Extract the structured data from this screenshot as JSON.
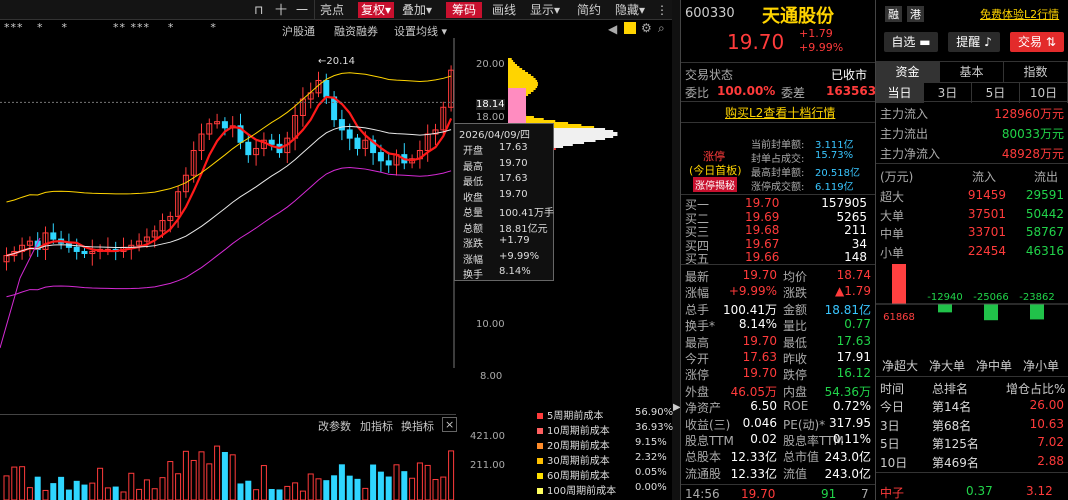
{
  "toolbar": {
    "items": [
      "十",
      "一",
      "亮点",
      "复权",
      "叠加",
      "筹码",
      "画线",
      "显示",
      "简约",
      "隐藏"
    ],
    "rows2": [
      "沪股通",
      "融资融券",
      "设置均线"
    ]
  },
  "chart": {
    "high_label": "20.14",
    "y_ticks": [
      "20.00",
      "18.14",
      "18.00",
      "10.00",
      "8.00"
    ],
    "vol_ticks": [
      "421.00",
      "211.00"
    ],
    "vol_menu": [
      "改参数",
      "加指标",
      "换指标"
    ]
  },
  "tooltip": {
    "date": "2026/04/09/四",
    "rows": [
      [
        "开盘",
        "17.63"
      ],
      [
        "最高",
        "19.70"
      ],
      [
        "最低",
        "17.63"
      ],
      [
        "收盘",
        "19.70"
      ],
      [
        "总量",
        "100.41万手"
      ],
      [
        "总额",
        "18.81亿元"
      ],
      [
        "涨跌",
        "+1.79"
      ],
      [
        "涨幅",
        "+9.99%"
      ],
      [
        "换手",
        "8.14%"
      ]
    ]
  },
  "chip_legend": [
    [
      "5周期前成本",
      "56.90%",
      "#ff3b3b"
    ],
    [
      "10周期前成本",
      "36.93%",
      "#ff6060"
    ],
    [
      "20周期前成本",
      "9.15%",
      "#ff8c2a"
    ],
    [
      "30周期前成本",
      "2.32%",
      "#ffc000"
    ],
    [
      "60周期前成本",
      "0.05%",
      "#ffe000"
    ],
    [
      "100周期前成本",
      "0.00%",
      "#ffff60"
    ]
  ],
  "stock": {
    "code": "600330",
    "name": "天通股份",
    "tag1": "融",
    "tag2": "港",
    "l2_link": "免费体验L2行情",
    "price": "19.70",
    "change": "+1.79",
    "pct": "+9.99%",
    "btn_zixuan": "自选",
    "btn_remind": "提醒",
    "btn_trade": "交易"
  },
  "status": {
    "label": "交易状态",
    "value": "已收市",
    "wb_label": "委比",
    "wb": "100.00%",
    "wc_label": "委差",
    "wc": "163563",
    "buy_link": "购买L2查看十档行情"
  },
  "limit": {
    "title": "涨停",
    "sub": "(今日首板)",
    "btn": "涨停揭秘",
    "rows": [
      [
        "当前封单额:",
        "3.111亿"
      ],
      [
        "封单占成交:",
        "15.73%"
      ],
      [
        "最高封单额:",
        "20.518亿"
      ],
      [
        "涨停成交额:",
        "6.119亿"
      ]
    ]
  },
  "bids": [
    [
      "买一",
      "19.70",
      "157905"
    ],
    [
      "买二",
      "19.69",
      "5265"
    ],
    [
      "买三",
      "19.68",
      "211"
    ],
    [
      "买四",
      "19.67",
      "34"
    ],
    [
      "买五",
      "19.66",
      "148"
    ]
  ],
  "quote": [
    [
      "最新",
      "19.70",
      "均价",
      "18.74"
    ],
    [
      "涨幅",
      "+9.99%",
      "涨跌",
      "▲1.79"
    ],
    [
      "总手",
      "100.41万",
      "金额",
      "18.81亿"
    ],
    [
      "换手*",
      "8.14%",
      "量比",
      "0.77"
    ],
    [
      "最高",
      "19.70",
      "最低",
      "17.63"
    ],
    [
      "今开",
      "17.63",
      "昨收",
      "17.91"
    ],
    [
      "涨停",
      "19.70",
      "跌停",
      "16.12"
    ],
    [
      "外盘",
      "46.05万",
      "内盘",
      "54.36万"
    ],
    [
      "净资产",
      "6.50",
      "ROE",
      "0.72%"
    ],
    [
      "收益(三)",
      "0.046",
      "PE(动)*",
      "317.95"
    ],
    [
      "股息TTM",
      "0.02",
      "股息率TTM",
      "0.11%"
    ],
    [
      "总股本",
      "12.33亿",
      "总市值",
      "243.0亿"
    ],
    [
      "流通股",
      "12.33亿",
      "流值",
      "243.0亿"
    ]
  ],
  "trade_last": [
    "14:56",
    "19.70",
    "91",
    "7"
  ],
  "tabs": [
    "资金",
    "基本",
    "指数"
  ],
  "subtabs": [
    "当日",
    "3日",
    "5日",
    "10日"
  ],
  "flow": [
    [
      "主力流入",
      "128960万元"
    ],
    [
      "主力流出",
      "80033万元"
    ],
    [
      "主力净流入",
      "48928万元"
    ]
  ],
  "flow_table": {
    "head": [
      "(万元)",
      "流入",
      "流出"
    ],
    "rows": [
      [
        "超大",
        "91459",
        "29591"
      ],
      [
        "大单",
        "37501",
        "50442"
      ],
      [
        "中单",
        "33701",
        "58767"
      ],
      [
        "小单",
        "22454",
        "46316"
      ]
    ]
  },
  "net_bars": {
    "values": [
      61868,
      -12940,
      -25066,
      -23862
    ],
    "labels": [
      "61868",
      "-12940",
      "-25066",
      "-23862"
    ],
    "names": [
      "净超大",
      "净大单",
      "净中单",
      "净小单"
    ]
  },
  "rank": {
    "head": [
      "时间",
      "总排名",
      "增仓占比%"
    ],
    "rows": [
      [
        "今日",
        "第14名",
        "26.00"
      ],
      [
        "3日",
        "第68名",
        "10.63"
      ],
      [
        "5日",
        "第125名",
        "7.02"
      ],
      [
        "10日",
        "第469名",
        "2.88"
      ]
    ]
  },
  "bottom_row": [
    "中子",
    "0.37",
    "3.12"
  ]
}
